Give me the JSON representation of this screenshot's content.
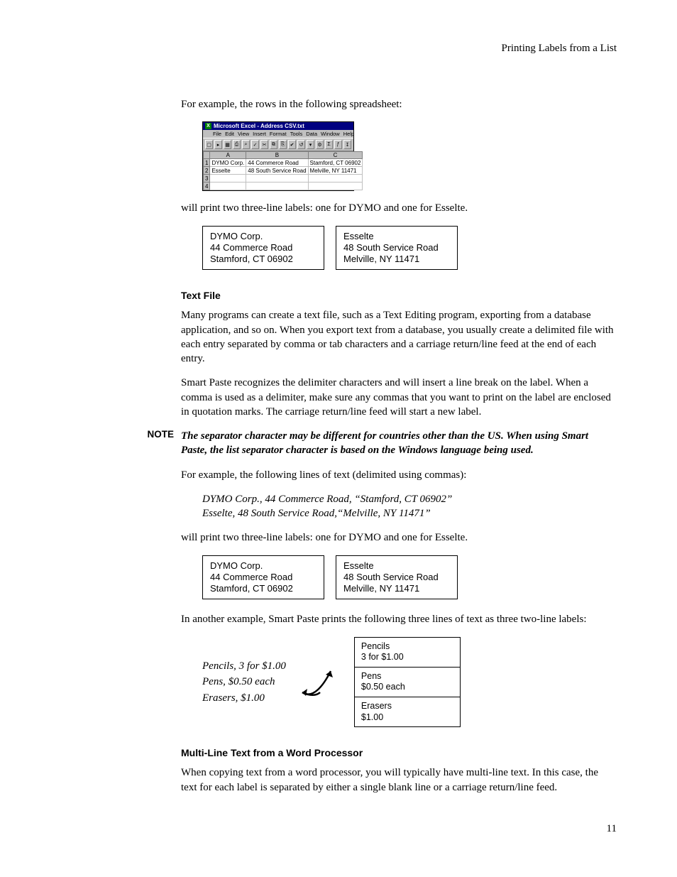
{
  "header": {
    "section": "Printing Labels from a List"
  },
  "intro1": "For example, the rows in the following spreadsheet:",
  "excel": {
    "title": "Microsoft Excel - Address CSV.txt",
    "menus": [
      "File",
      "Edit",
      "View",
      "Insert",
      "Format",
      "Tools",
      "Data",
      "Window",
      "Help"
    ],
    "tool_glyphs": [
      "▢",
      "▸",
      "▦",
      "⎙",
      "⌕",
      "✓",
      "✂",
      "⧉",
      "⎘",
      "✔",
      "↺",
      "▾",
      "⚙",
      "Σ",
      "ƒ",
      "↧"
    ],
    "cols": [
      "A",
      "B",
      "C"
    ],
    "row_nums": [
      "1",
      "2",
      "3",
      "4"
    ],
    "rows": [
      [
        "DYMO Corp.",
        "44 Commerce Road",
        "Stamford, CT 06902"
      ],
      [
        "Esselte",
        "48 South Service Road",
        "Melville, NY 11471"
      ],
      [
        "",
        "",
        ""
      ],
      [
        "",
        "",
        ""
      ]
    ]
  },
  "after_sheet": "will print two three-line labels: one for DYMO and one for Esselte.",
  "labels1": {
    "a": [
      "DYMO Corp.",
      "44 Commerce Road",
      "Stamford, CT 06902"
    ],
    "b": [
      "Esselte",
      "48 South Service Road",
      "Melville, NY 11471"
    ]
  },
  "h_textfile": "Text File",
  "textfile_p1": "Many programs can create a text file, such as a Text Editing program, exporting from a database application, and so on. When you export text from a database, you usually create a delimited file with each entry separated by comma or tab characters and a carriage return/line feed at the end of each entry.",
  "textfile_p2": "Smart Paste recognizes the delimiter characters and will insert a line break on the label. When a comma is used as a delimiter, make sure any commas that you want to print on the label are enclosed in quotation marks. The carriage return/line feed will start a new label.",
  "note_label": "NOTE",
  "note_text": "The separator character may be different for countries other than the US. When using Smart Paste, the list separator character is based on the Windows language being used.",
  "example_intro": "For example, the following lines of text (delimited using commas):",
  "example_lines": {
    "l1": "DYMO Corp., 44 Commerce Road, “Stamford, CT 06902”",
    "l2": "Esselte, 48 South Service Road,“Melville, NY 11471”"
  },
  "after_example": "will print two three-line labels: one for DYMO and one for Esselte.",
  "labels2": {
    "a": [
      "DYMO Corp.",
      "44 Commerce Road",
      "Stamford, CT 06902"
    ],
    "b": [
      "Esselte",
      "48 South Service Road",
      "Melville, NY 11471"
    ]
  },
  "another_intro": "In another example, Smart Paste prints the following three lines of text as three two-line labels:",
  "arrow_input": {
    "l1": "Pencils, 3 for $1.00",
    "l2": "Pens, $0.50 each",
    "l3": "Erasers, $1.00"
  },
  "labels3": {
    "a": [
      "Pencils",
      "3 for $1.00"
    ],
    "b": [
      "Pens",
      "$0.50 each"
    ],
    "c": [
      "Erasers",
      "$1.00"
    ]
  },
  "h_multiline": "Multi-Line Text from a Word Processor",
  "multiline_p": "When copying text from a word processor, you will typically have multi-line text. In this case, the text for each label is separated by either a single blank line or a carriage return/line feed.",
  "page_number": "11"
}
